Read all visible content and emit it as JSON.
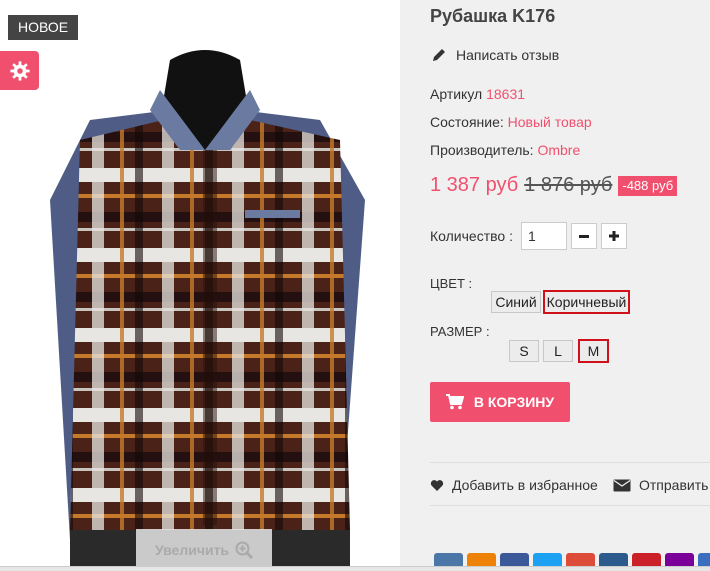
{
  "badge": {
    "label": "НОВОЕ"
  },
  "zoom": {
    "label": "Увеличить"
  },
  "product": {
    "title": "Рубашка K176",
    "review_link": "Написать отзыв",
    "article_label": "Артикул",
    "article_value": "18631",
    "condition_label": "Состояние:",
    "condition_value": "Новый товар",
    "manufacturer_label": "Производитель:",
    "manufacturer_value": "Ombre"
  },
  "price": {
    "current": "1 387 руб",
    "old": "1 876 руб",
    "discount": "-488 руб"
  },
  "quantity": {
    "label": "Количество :",
    "value": "1",
    "minus_icon": "minus-icon",
    "plus_icon": "plus-icon"
  },
  "color": {
    "label": "ЦВЕТ :",
    "options": [
      "Синий",
      "Коричневый"
    ],
    "selected": "Коричневый"
  },
  "size": {
    "label": "РАЗМЕР :",
    "options": [
      "S",
      "L",
      "M"
    ],
    "selected": "M"
  },
  "cart": {
    "label": "В КОРЗИНУ"
  },
  "actions": {
    "wishlist": "Добавить в избранное",
    "send": "Отправить"
  },
  "colors": {
    "accent": "#f0506e",
    "selected_border": "#d0101a",
    "badge_bg": "#444444"
  },
  "share_buttons": [
    {
      "icon": "vk-icon",
      "color": "#4a76a8"
    },
    {
      "icon": "odnoklassniki-icon",
      "color": "#ee8208"
    },
    {
      "icon": "facebook-icon",
      "color": "#3b5998"
    },
    {
      "icon": "twitter-icon",
      "color": "#1da1f2"
    },
    {
      "icon": "google-plus-icon",
      "color": "#dd4b39"
    },
    {
      "icon": "livejournal-icon",
      "color": "#2c5a8c"
    },
    {
      "icon": "pinterest-icon",
      "color": "#cb2027"
    },
    {
      "icon": "yahoo-icon",
      "color": "#7b0099"
    },
    {
      "icon": "email-icon",
      "color": "#3a6fbf"
    }
  ]
}
